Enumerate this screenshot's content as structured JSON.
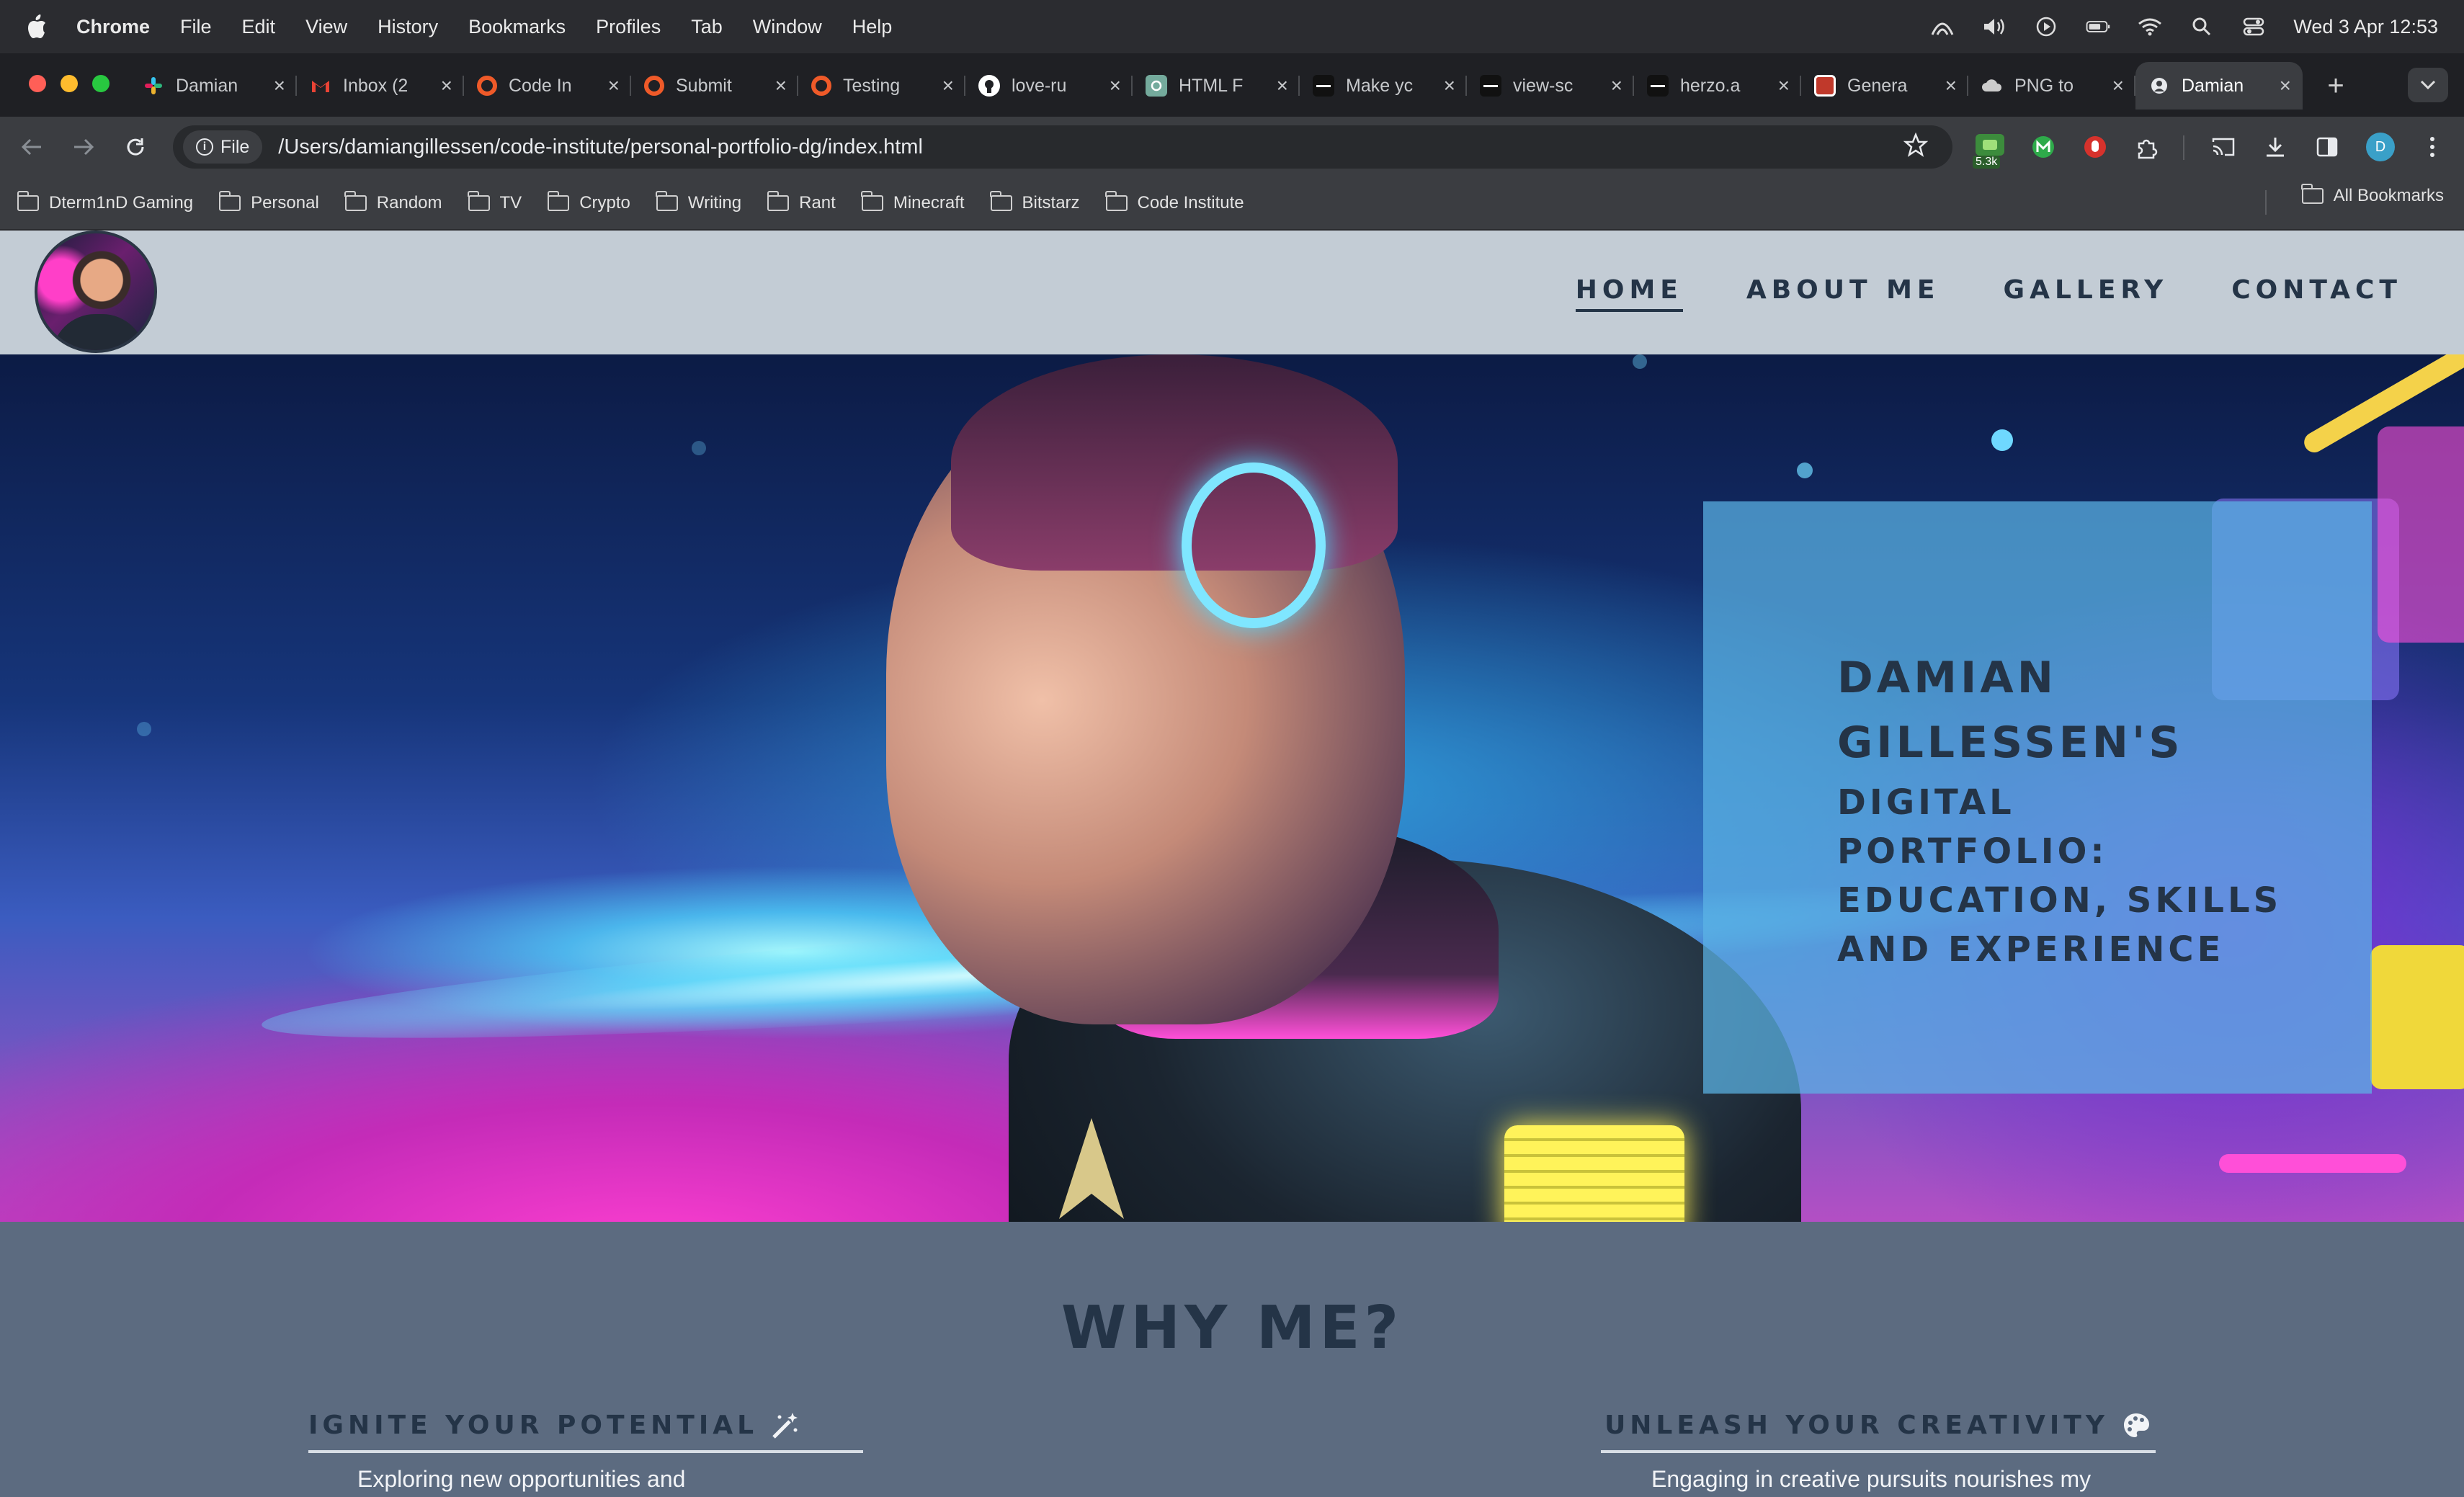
{
  "menubar": {
    "app": "Chrome",
    "items": [
      "File",
      "Edit",
      "View",
      "History",
      "Bookmarks",
      "Profiles",
      "Tab",
      "Window",
      "Help"
    ],
    "datetime": "Wed 3 Apr  12:53"
  },
  "tabs": [
    {
      "title": "Damian",
      "icon": "slack-icon",
      "color": "#e01e5a"
    },
    {
      "title": "Inbox (2",
      "icon": "gmail-icon",
      "color": "#ea4335"
    },
    {
      "title": "Code In",
      "icon": "codeinstitute-icon",
      "color": "#ef5a29"
    },
    {
      "title": "Submit",
      "icon": "codeinstitute-icon",
      "color": "#ef5a29"
    },
    {
      "title": "Testing",
      "icon": "codeinstitute-icon",
      "color": "#ef5a29"
    },
    {
      "title": "love-ru",
      "icon": "github-icon",
      "color": "#ffffff"
    },
    {
      "title": "HTML F",
      "icon": "chatgpt-icon",
      "color": "#74aa9c"
    },
    {
      "title": "Make yc",
      "icon": "site-icon",
      "color": "#111111"
    },
    {
      "title": "view-sc",
      "icon": "site-icon",
      "color": "#111111"
    },
    {
      "title": "herzo.a",
      "icon": "site-icon",
      "color": "#111111"
    },
    {
      "title": "Genera",
      "icon": "generator-icon",
      "color": "#c0392b"
    },
    {
      "title": "PNG to",
      "icon": "cloud-icon",
      "color": "#cccccc"
    },
    {
      "title": "Damian",
      "icon": "globe-icon",
      "color": "#e8eaed",
      "active": true
    }
  ],
  "toolbar": {
    "chip": "File",
    "url": "/Users/damiangillessen/code-institute/personal-portfolio-dg/index.html",
    "extension_badge": "5.3k",
    "profile_initial": "D"
  },
  "bookmarks": {
    "items": [
      "Dterm1nD Gaming",
      "Personal",
      "Random",
      "TV",
      "Crypto",
      "Writing",
      "Rant",
      "Minecraft",
      "Bitstarz",
      "Code Institute"
    ],
    "all": "All Bookmarks"
  },
  "site": {
    "nav": [
      "HOME",
      "ABOUT ME",
      "GALLERY",
      "CONTACT"
    ],
    "hero": {
      "title_line1": "DAMIAN",
      "title_line2": "GILLESSEN'S",
      "subtitle": "DIGITAL PORTFOLIO: EDUCATION, SKILLS AND EXPERIENCE"
    },
    "why": {
      "heading": "WHY ME?",
      "left": {
        "title": "IGNITE YOUR POTENTIAL",
        "icon": "magic-wand-icon",
        "text": "Exploring new opportunities and"
      },
      "right": {
        "title": "UNLEASH YOUR CREATIVITY",
        "icon": "palette-icon",
        "text": "Engaging in creative pursuits nourishes my"
      }
    }
  }
}
